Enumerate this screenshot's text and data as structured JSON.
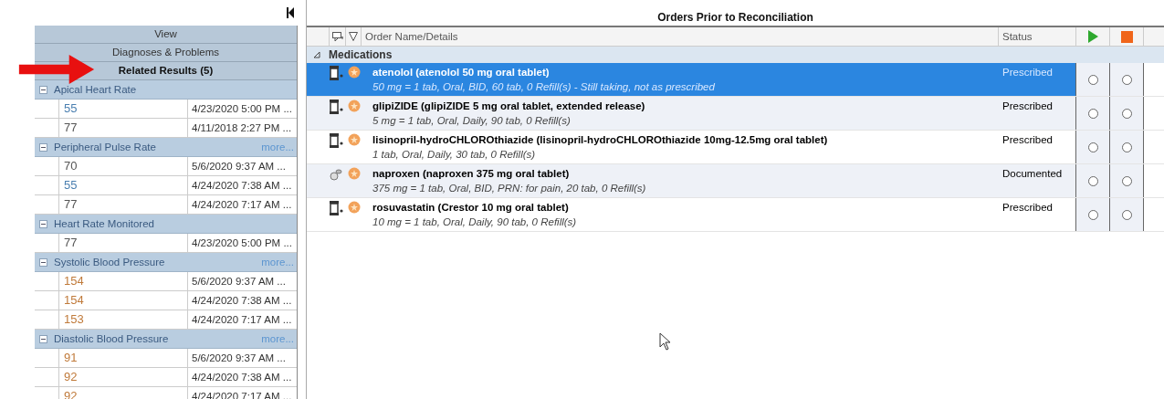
{
  "left_panel": {
    "view_header": "View",
    "sections": [
      {
        "label": "Diagnoses & Problems",
        "selected": false
      },
      {
        "label": "Related Results (5)",
        "selected": true
      }
    ],
    "groups": [
      {
        "name": "Apical Heart Rate",
        "expanded": true,
        "rows": [
          {
            "value": "55",
            "color": "#4a7fb0",
            "time": "4/23/2020 5:00 PM ..."
          },
          {
            "value": "77",
            "color": "#555555",
            "time": "4/11/2018 2:27 PM ..."
          }
        ]
      },
      {
        "name": "Peripheral Pulse Rate",
        "expanded": true,
        "more": "more...",
        "rows": [
          {
            "value": "70",
            "color": "#555555",
            "time": "5/6/2020 9:37 AM ..."
          },
          {
            "value": "55",
            "color": "#4a7fb0",
            "time": "4/24/2020 7:38 AM ..."
          },
          {
            "value": "77",
            "color": "#555555",
            "time": "4/24/2020 7:17 AM ..."
          }
        ]
      },
      {
        "name": "Heart Rate Monitored",
        "expanded": true,
        "rows": [
          {
            "value": "77",
            "color": "#555555",
            "time": "4/23/2020 5:00 PM ..."
          }
        ]
      },
      {
        "name": "Systolic Blood Pressure",
        "expanded": true,
        "more": "more...",
        "rows": [
          {
            "value": "154",
            "color": "#c07a3a",
            "time": "5/6/2020 9:37 AM ..."
          },
          {
            "value": "154",
            "color": "#c07a3a",
            "time": "4/24/2020 7:38 AM ..."
          },
          {
            "value": "153",
            "color": "#c07a3a",
            "time": "4/24/2020 7:17 AM ..."
          }
        ]
      },
      {
        "name": "Diastolic Blood Pressure",
        "expanded": true,
        "more": "more...",
        "rows": [
          {
            "value": "91",
            "color": "#c07a3a",
            "time": "5/6/2020 9:37 AM ..."
          },
          {
            "value": "92",
            "color": "#c07a3a",
            "time": "4/24/2020 7:38 AM ..."
          },
          {
            "value": "92",
            "color": "#c07a3a",
            "time": "4/24/2020 7:17 AM ..."
          }
        ]
      }
    ]
  },
  "orders": {
    "title": "Orders Prior to Reconciliation",
    "columns": {
      "name": "Order Name/Details",
      "status": "Status"
    },
    "group": {
      "label": "Medications",
      "expanded": true
    },
    "rows": [
      {
        "kind": "prescription",
        "name": "atenolol (atenolol 50 mg oral tablet)",
        "details": "50 mg = 1 tab, Oral, BID, 60 tab, 0 Refill(s) - Still taking, not as prescribed",
        "status": "Prescribed",
        "selected": true,
        "continue": false,
        "discontinue": false
      },
      {
        "kind": "prescription",
        "name": "glipiZIDE (glipiZIDE 5 mg oral tablet, extended release)",
        "details": "5 mg = 1 tab, Oral, Daily, 90 tab, 0 Refill(s)",
        "status": "Prescribed",
        "selected": false,
        "continue": false,
        "discontinue": false
      },
      {
        "kind": "prescription",
        "name": "lisinopril-hydroCHLOROthiazide (lisinopril-hydroCHLOROthiazide 10mg-12.5mg oral tablet)",
        "details": "1 tab, Oral, Daily, 30 tab, 0 Refill(s)",
        "status": "Prescribed",
        "selected": false,
        "continue": false,
        "discontinue": false
      },
      {
        "kind": "documented",
        "name": "naproxen (naproxen 375 mg oral tablet)",
        "details": "375 mg = 1 tab, Oral, BID, PRN: for pain, 20 tab, 0 Refill(s)",
        "status": "Documented",
        "selected": false,
        "continue": false,
        "discontinue": false
      },
      {
        "kind": "prescription",
        "name": "rosuvastatin (Crestor 10 mg oral tablet)",
        "details": "10 mg = 1 tab, Oral, Daily, 90 tab, 0 Refill(s)",
        "status": "Prescribed",
        "selected": false,
        "continue": false,
        "discontinue": false
      }
    ]
  }
}
